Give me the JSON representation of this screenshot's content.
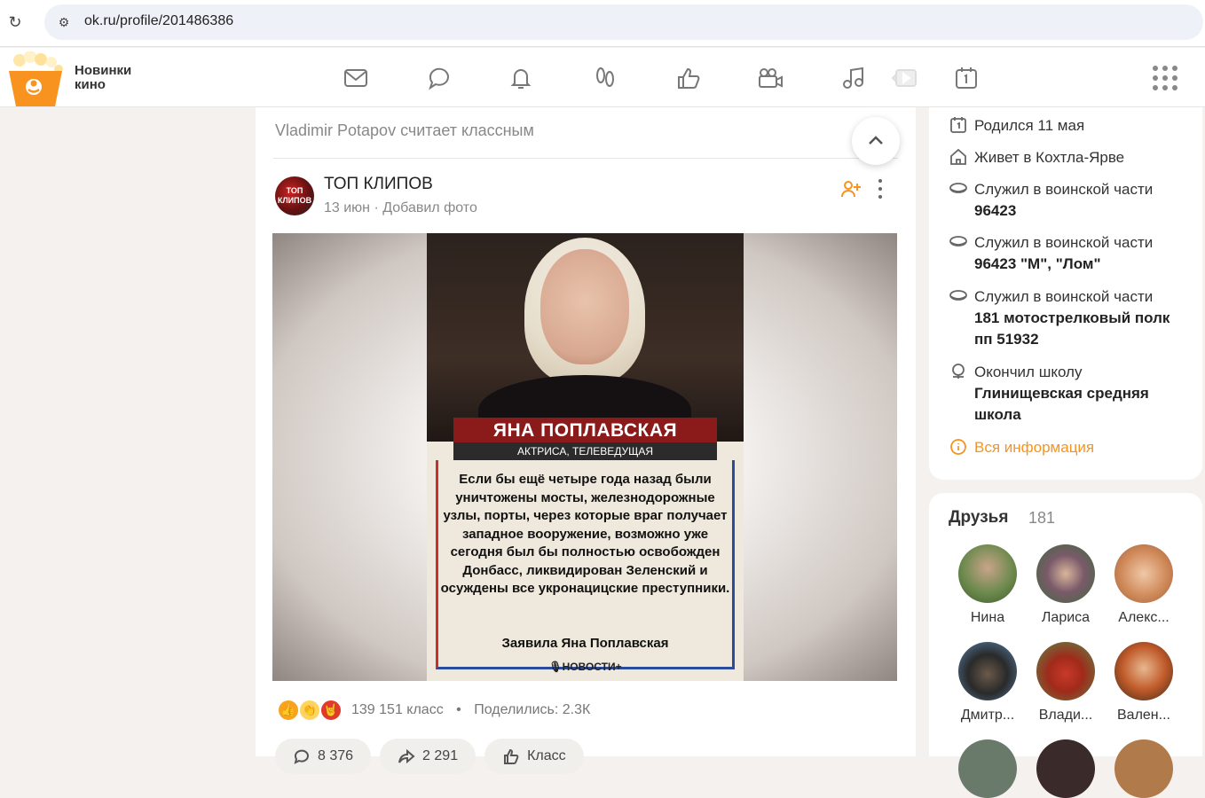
{
  "browser": {
    "url": "ok.ru/profile/201486386"
  },
  "topnav": {
    "promo_line1": "Новинки",
    "promo_line2": "кино",
    "icons": [
      "messages-icon",
      "discussions-icon",
      "notifications-icon",
      "guests-icon",
      "events-icon",
      "video-icon",
      "music-icon",
      "video-play-icon",
      "calendar-icon",
      "apps-grid-icon"
    ]
  },
  "feed": {
    "liked_by": "Vladimir Potapov считает классным",
    "post": {
      "group_name": "ТОП КЛИПОВ",
      "avatar_text": "ТОП КЛИПОВ",
      "date": "13 июн",
      "action": "Добавил фото",
      "image": {
        "name": "ЯНА ПОПЛАВСКАЯ",
        "role": "АКТРИСА, ТЕЛЕВЕДУЩАЯ",
        "quote": "Если бы ещё четыре года назад были уничтожены мосты, железнодорожные узлы, порты, через которые враг получает западное вооружение, возможно уже сегодня был бы полностью освобожден Донбасс, ликвидирован Зеленский и осуждены все укронацицские преступники.",
        "author": "Заявила Яна Поплавская",
        "source": "НОВОСТИ+"
      },
      "klass_count": "139 151 класс",
      "shares": "Поделились: 2.3К",
      "buttons": {
        "comments": "8 376",
        "share": "2 291",
        "klass": "Класс"
      }
    }
  },
  "profile_info": {
    "birthday": "Родился 11 мая",
    "lives": "Живет в Кохтла-Ярве",
    "military_1_label": "Служил в воинской части",
    "military_1_value": "96423",
    "military_2_label": "Служил в воинской части",
    "military_2_value": "96423 \"М\", \"Лом\"",
    "military_3_label": "Служил в воинской части",
    "military_3_value": "181 мотострелковый полк пп 51932",
    "school_label": "Окончил школу",
    "school_value": "Глинищевская средняя школа",
    "all_info": "Вся информация"
  },
  "friends": {
    "title": "Друзья",
    "count": "181",
    "list": [
      {
        "name": "Нина"
      },
      {
        "name": "Лариса"
      },
      {
        "name": "Алекс..."
      },
      {
        "name": "Дмитр..."
      },
      {
        "name": "Влади..."
      },
      {
        "name": "Вален..."
      }
    ]
  },
  "colors": {
    "accent": "#f7931e",
    "plate_red": "#8b1a1a"
  }
}
